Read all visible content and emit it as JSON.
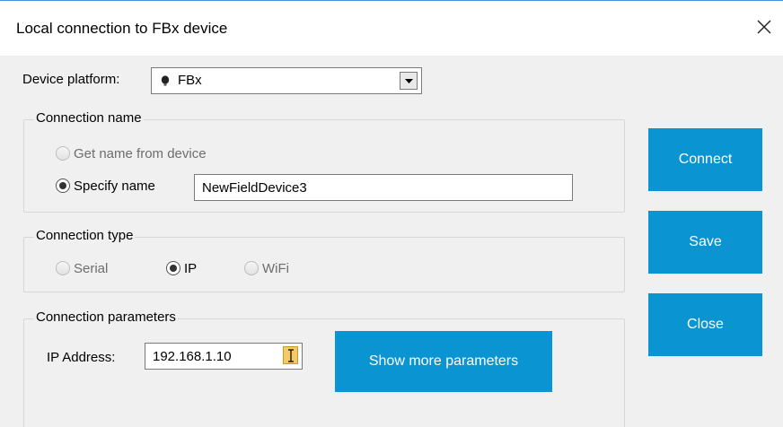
{
  "window": {
    "title": "Local connection to FBx device"
  },
  "device_platform": {
    "label": "Device platform:",
    "selected": "FBx"
  },
  "connection_name": {
    "group_label": "Connection name",
    "option_from_device": "Get name from device",
    "option_specify": "Specify name",
    "name_value": "NewFieldDevice3"
  },
  "connection_type": {
    "group_label": "Connection type",
    "options": [
      "Serial",
      "IP",
      "WiFi"
    ]
  },
  "connection_parameters": {
    "group_label": "Connection parameters",
    "ip_label": "IP Address:",
    "ip_value": "192.168.1.10",
    "more_button": "Show more parameters"
  },
  "actions": {
    "connect": "Connect",
    "save": "Save",
    "close": "Close"
  },
  "colors": {
    "button_blue": "#0a95d2",
    "dialog_bg": "#f0f0f0"
  },
  "icons": {
    "device": "device-icon",
    "dropdown": "dropdown-arrow-icon",
    "close": "close-icon",
    "cursor": "text-cursor-icon"
  }
}
